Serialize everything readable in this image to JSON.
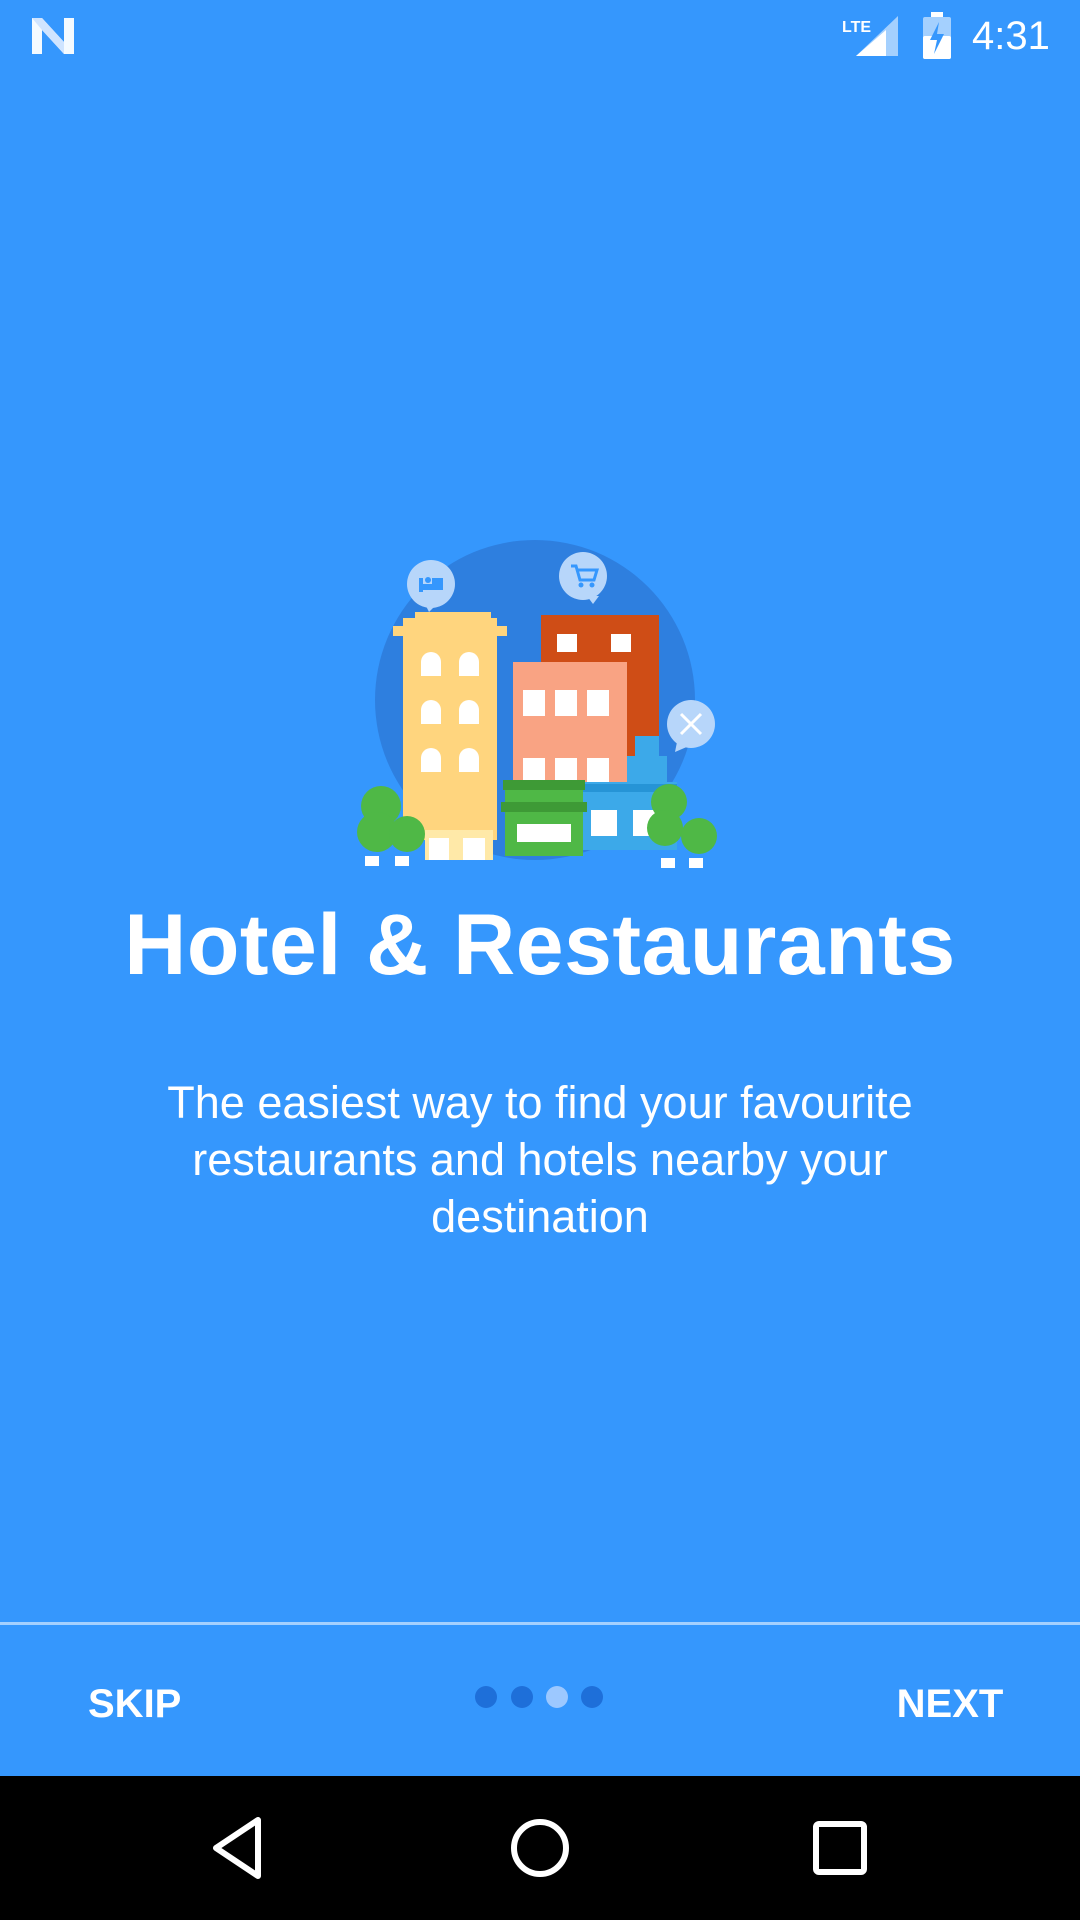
{
  "status_bar": {
    "time": "4:31",
    "network_label": "LTE",
    "icons": [
      "notification-n-icon",
      "lte-signal-icon",
      "battery-charging-icon"
    ]
  },
  "onboarding": {
    "illustration": "city-buildings-illustration",
    "title": "Hotel & Restaurants",
    "description": "The easiest way to find your favourite restaurants and hotels nearby your destination",
    "page_indicator": {
      "total": 4,
      "current": 3
    }
  },
  "footer": {
    "skip_label": "SKIP",
    "next_label": "NEXT"
  },
  "nav_bar": {
    "icons": [
      "back-icon",
      "home-icon",
      "recents-icon"
    ]
  },
  "colors": {
    "background": "#3597FD",
    "dot_inactive": "#1E6FD9",
    "dot_active": "#9CC8FF"
  }
}
